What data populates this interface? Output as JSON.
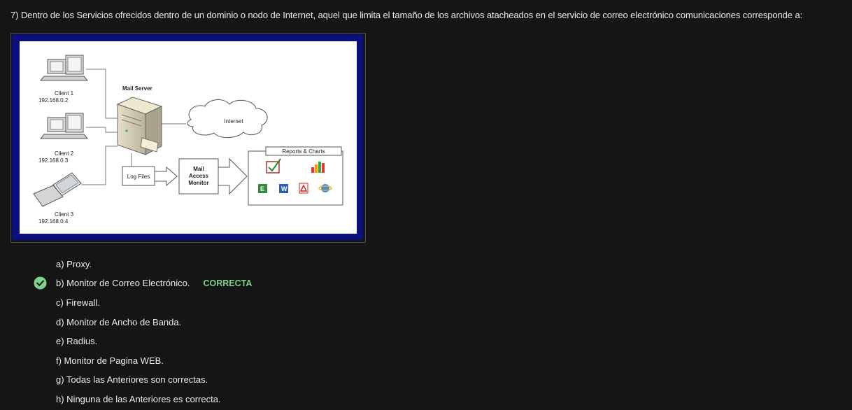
{
  "question": {
    "text": "7) Dentro de los Servicios ofrecidos dentro de un dominio o nodo de Internet, aquel que limita el tamaño de los archivos atacheados en el servicio de correo electrónico comunicaciones corresponde a:"
  },
  "diagram": {
    "client1_name": "Client 1",
    "client1_ip": "192.168.0.2",
    "client2_name": "Client 2",
    "client2_ip": "192.168.0.3",
    "client3_name": "Client 3",
    "client3_ip": "192.168.0.4",
    "mail_server": "Mail Server",
    "internet": "Internet",
    "log_files": "Log Files",
    "monitor_line1": "Mail",
    "monitor_line2": "Access",
    "monitor_line3": "Monitor",
    "reports": "Reports & Charts"
  },
  "options": [
    {
      "label": "a) Proxy."
    },
    {
      "label": "b) Monitor de Correo Electrónico.",
      "status": "CORRECTA"
    },
    {
      "label": "c) Firewall."
    },
    {
      "label": "d) Monitor de Ancho de Banda."
    },
    {
      "label": "e) Radius."
    },
    {
      "label": "f) Monitor de Pagina WEB."
    },
    {
      "label": "g) Todas las Anteriores son correctas."
    },
    {
      "label": "h) Ninguna de las Anteriores es correcta."
    }
  ],
  "colors": {
    "background": "#151515",
    "correct": "#7fd18a",
    "frame_blue": "#0d0f80"
  },
  "icons": {
    "correct_marker": "check-circle-icon"
  }
}
